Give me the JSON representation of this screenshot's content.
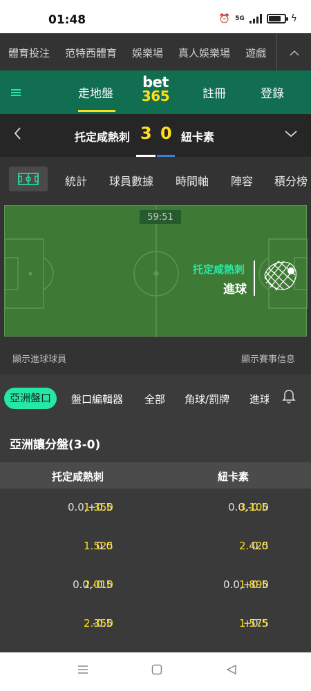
{
  "status_bar": {
    "time": "01:48",
    "network": "5G",
    "battery_level": 0.8
  },
  "category_nav": {
    "items": [
      "體育投注",
      "范特西體育",
      "娛樂場",
      "真人娛樂場",
      "遊戲"
    ]
  },
  "header": {
    "live": "走地盤",
    "logo_top": "bet",
    "logo_bottom": "365",
    "register": "註冊",
    "login": "登錄"
  },
  "match": {
    "home_team": "托定咸熱刺",
    "home_score": "3",
    "away_score": "0",
    "away_team": "紐卡素"
  },
  "stat_tabs": [
    "統計",
    "球員數據",
    "時間軸",
    "陣容",
    "積分榜"
  ],
  "pitch": {
    "clock": "59:51",
    "event_team": "托定咸熱刺",
    "event_type": "進球",
    "show_scorers": "顯示進球球員",
    "show_match_info": "顯示賽事信息"
  },
  "market_tabs": {
    "active": "亞洲盤口",
    "items": [
      "盤口編輯器",
      "全部",
      "角球/罰牌"
    ],
    "clipped": "進球"
  },
  "market": {
    "title": "亞洲讓分盤(3-0)",
    "home_header": "托定咸熱刺",
    "away_header": "紐卡素",
    "rows": [
      {
        "home_line": "0.0,+0.5",
        "home_odds": "1.350",
        "away_line": "0.0,-0.5",
        "away_odds": "3.100"
      },
      {
        "home_line": "0.0",
        "home_odds": "1.525",
        "away_line": "0.0",
        "away_odds": "2.425"
      },
      {
        "home_line": "0.0,-0.5",
        "home_odds": "2.010",
        "away_line": "0.0,+0.5",
        "away_odds": "1.890"
      },
      {
        "home_line": "-0.5",
        "home_odds": "2.350",
        "away_line": "+0.5",
        "away_odds": "1.575"
      }
    ]
  },
  "colors": {
    "brand_green": "#126e51",
    "accent_green": "#26e8a5",
    "accent_yellow": "#ffdf1b",
    "away_color": "#3f7fd0"
  }
}
